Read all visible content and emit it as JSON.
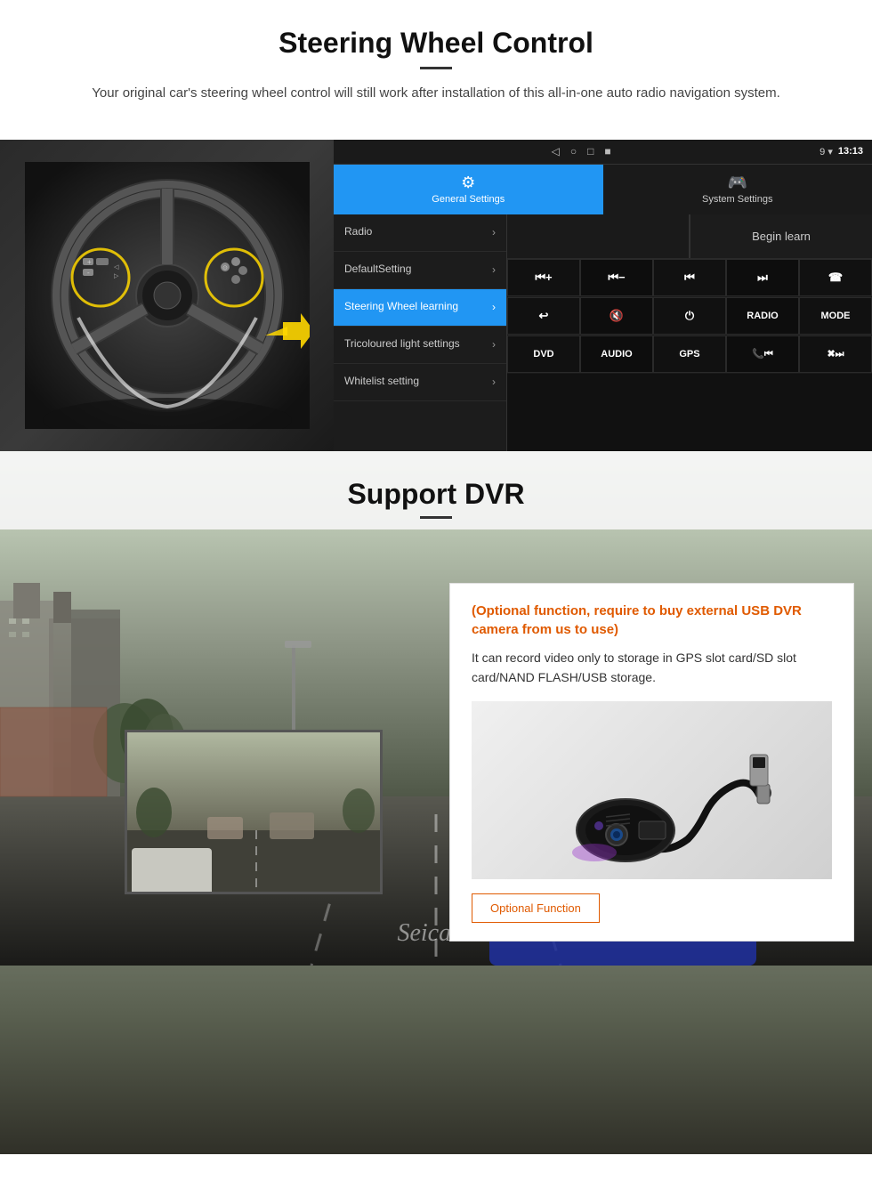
{
  "section1": {
    "title": "Steering Wheel Control",
    "subtitle": "Your original car's steering wheel control will still work after installation of this all-in-one auto radio navigation system.",
    "statusBar": {
      "navButtons": [
        "◁",
        "○",
        "□",
        "■"
      ],
      "signals": "9 ▾",
      "time": "13:13"
    },
    "tabs": {
      "general": {
        "icon": "⚙",
        "label": "General Settings"
      },
      "system": {
        "icon": "🎮",
        "label": "System Settings"
      }
    },
    "menuItems": [
      {
        "label": "Radio",
        "active": false
      },
      {
        "label": "DefaultSetting",
        "active": false
      },
      {
        "label": "Steering Wheel learning",
        "active": true
      },
      {
        "label": "Tricoloured light settings",
        "active": false
      },
      {
        "label": "Whitelist setting",
        "active": false
      }
    ],
    "beginLearn": "Begin learn",
    "controlRows": [
      [
        "⏮+",
        "⏮-",
        "⏮⏮",
        "⏭⏭",
        "☎"
      ],
      [
        "↩",
        "🔇",
        "⏻",
        "RADIO",
        "MODE"
      ],
      [
        "DVD",
        "AUDIO",
        "GPS",
        "📞⏮",
        "✖⏭"
      ]
    ]
  },
  "section2": {
    "title": "Support DVR",
    "infoCard": {
      "optionalText": "(Optional function, require to buy external USB DVR camera from us to use)",
      "description": "It can record video only to storage in GPS slot card/SD slot card/NAND FLASH/USB storage.",
      "optionalFunctionLabel": "Optional Function"
    },
    "watermark": "Seicane"
  }
}
